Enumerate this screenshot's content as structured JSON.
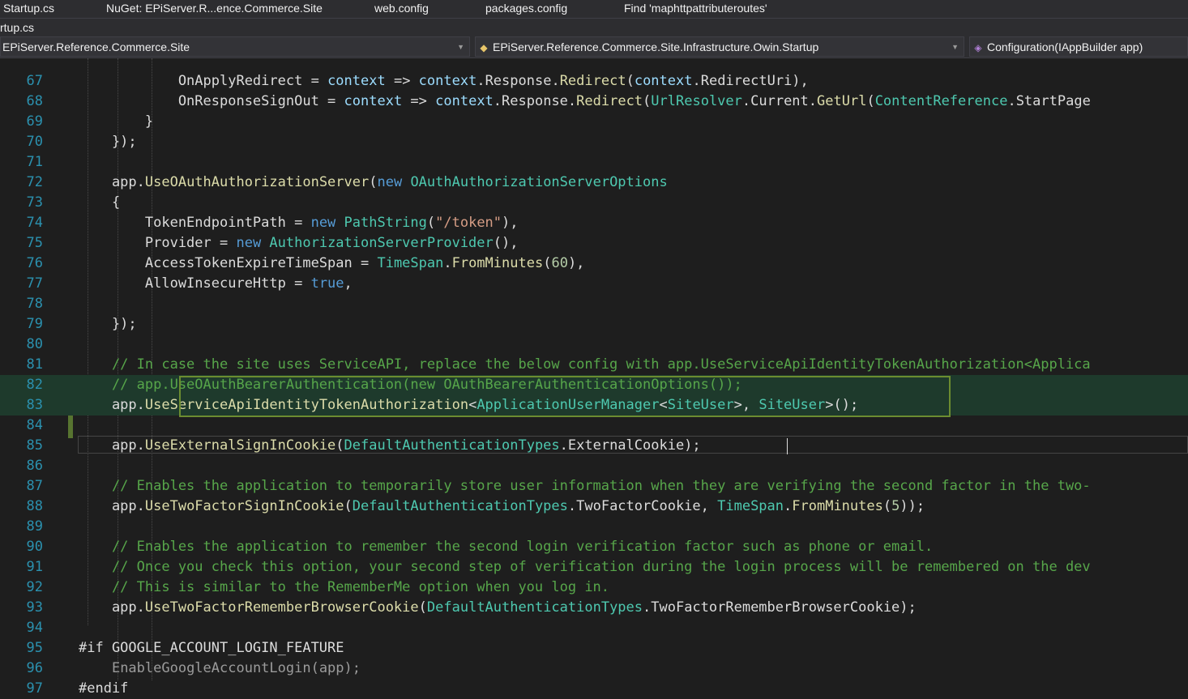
{
  "tabs": [
    {
      "label": "Startup.cs"
    },
    {
      "label": "NuGet: EPiServer.R...ence.Commerce.Site"
    },
    {
      "label": "web.config"
    },
    {
      "label": "packages.config"
    },
    {
      "label": "Find 'maphttpattributeroutes'"
    }
  ],
  "path_label": "rtup.cs",
  "navbar": {
    "project": "EPiServer.Reference.Commerce.Site",
    "type": "EPiServer.Reference.Commerce.Site.Infrastructure.Owin.Startup",
    "member": "Configuration(IAppBuilder app)"
  },
  "lines": [
    {
      "n": "",
      "tokens": [
        [
          "                                                  ",
          ""
        ],
        [
          "",
          ""
        ]
      ]
    },
    {
      "n": "67",
      "tokens": [
        [
          "            OnApplyRedirect ",
          ""
        ],
        [
          "= ",
          ""
        ],
        [
          "context",
          "pa"
        ],
        [
          " => ",
          ""
        ],
        [
          "context",
          "pa"
        ],
        [
          ".Response.",
          ""
        ],
        [
          "Redirect",
          "fn"
        ],
        [
          "(",
          ""
        ],
        [
          "context",
          "pa"
        ],
        [
          ".RedirectUri),",
          ""
        ]
      ]
    },
    {
      "n": "68",
      "tokens": [
        [
          "            OnResponseSignOut ",
          ""
        ],
        [
          "= ",
          ""
        ],
        [
          "context",
          "pa"
        ],
        [
          " => ",
          ""
        ],
        [
          "context",
          "pa"
        ],
        [
          ".Response.",
          ""
        ],
        [
          "Redirect",
          "fn"
        ],
        [
          "(",
          ""
        ],
        [
          "UrlResolver",
          "ty"
        ],
        [
          ".Current.",
          ""
        ],
        [
          "GetUrl",
          "fn"
        ],
        [
          "(",
          ""
        ],
        [
          "ContentReference",
          "ty"
        ],
        [
          ".StartPage",
          ""
        ]
      ]
    },
    {
      "n": "69",
      "tokens": [
        [
          "        }",
          ""
        ]
      ]
    },
    {
      "n": "70",
      "tokens": [
        [
          "    });",
          ""
        ]
      ]
    },
    {
      "n": "71",
      "tokens": []
    },
    {
      "n": "72",
      "tokens": [
        [
          "    app.",
          ""
        ],
        [
          "UseOAuthAuthorizationServer",
          "fn"
        ],
        [
          "(",
          ""
        ],
        [
          "new ",
          "kw"
        ],
        [
          "OAuthAuthorizationServerOptions",
          "ty"
        ]
      ]
    },
    {
      "n": "73",
      "tokens": [
        [
          "    {",
          ""
        ]
      ]
    },
    {
      "n": "74",
      "tokens": [
        [
          "        TokenEndpointPath = ",
          ""
        ],
        [
          "new ",
          "kw"
        ],
        [
          "PathString",
          "ty"
        ],
        [
          "(",
          ""
        ],
        [
          "\"/token\"",
          "st"
        ],
        [
          "),",
          ""
        ]
      ]
    },
    {
      "n": "75",
      "tokens": [
        [
          "        Provider = ",
          ""
        ],
        [
          "new ",
          "kw"
        ],
        [
          "AuthorizationServerProvider",
          "ty"
        ],
        [
          "(),",
          ""
        ]
      ]
    },
    {
      "n": "76",
      "tokens": [
        [
          "        AccessTokenExpireTimeSpan = ",
          ""
        ],
        [
          "TimeSpan",
          "ty"
        ],
        [
          ".",
          ""
        ],
        [
          "FromMinutes",
          "fn"
        ],
        [
          "(",
          ""
        ],
        [
          "60",
          "nm"
        ],
        [
          "),",
          ""
        ]
      ]
    },
    {
      "n": "77",
      "tokens": [
        [
          "        AllowInsecureHttp = ",
          ""
        ],
        [
          "true",
          "kw"
        ],
        [
          ",",
          ""
        ]
      ]
    },
    {
      "n": "78",
      "tokens": []
    },
    {
      "n": "79",
      "tokens": [
        [
          "    });",
          ""
        ]
      ]
    },
    {
      "n": "80",
      "tokens": []
    },
    {
      "n": "81",
      "tokens": [
        [
          "    // In case the site uses ServiceAPI, replace the below config with app.UseServiceApiIdentityTokenAuthorization<Applica",
          "cm"
        ]
      ]
    },
    {
      "n": "82",
      "tokens": [
        [
          "    // app.UseOAuthBearerAuthentication(new OAuthBearerAuthenticationOptions());",
          "cm"
        ]
      ]
    },
    {
      "n": "83",
      "tokens": [
        [
          "    app.",
          ""
        ],
        [
          "UseServiceApiIdentityTokenAuthorization",
          "fn"
        ],
        [
          "<",
          ""
        ],
        [
          "ApplicationUserManager",
          "ty"
        ],
        [
          "<",
          ""
        ],
        [
          "SiteUser",
          "ty"
        ],
        [
          ">, ",
          ""
        ],
        [
          "SiteUser",
          "ty"
        ],
        [
          ">();",
          ""
        ]
      ]
    },
    {
      "n": "84",
      "tokens": []
    },
    {
      "n": "85",
      "tokens": [
        [
          "    app.",
          ""
        ],
        [
          "UseExternalSignInCookie",
          "fn"
        ],
        [
          "(",
          ""
        ],
        [
          "DefaultAuthenticationTypes",
          "ty"
        ],
        [
          ".ExternalCookie);",
          ""
        ]
      ]
    },
    {
      "n": "86",
      "tokens": []
    },
    {
      "n": "87",
      "tokens": [
        [
          "    // Enables the application to temporarily store user information when they are verifying the second factor in the two-",
          "cm"
        ]
      ]
    },
    {
      "n": "88",
      "tokens": [
        [
          "    app.",
          ""
        ],
        [
          "UseTwoFactorSignInCookie",
          "fn"
        ],
        [
          "(",
          ""
        ],
        [
          "DefaultAuthenticationTypes",
          "ty"
        ],
        [
          ".TwoFactorCookie, ",
          ""
        ],
        [
          "TimeSpan",
          "ty"
        ],
        [
          ".",
          ""
        ],
        [
          "FromMinutes",
          "fn"
        ],
        [
          "(",
          ""
        ],
        [
          "5",
          "nm"
        ],
        [
          "));",
          ""
        ]
      ]
    },
    {
      "n": "89",
      "tokens": []
    },
    {
      "n": "90",
      "tokens": [
        [
          "    // Enables the application to remember the second login verification factor such as phone or email.",
          "cm"
        ]
      ]
    },
    {
      "n": "91",
      "tokens": [
        [
          "    // Once you check this option, your second step of verification during the login process will be remembered on the dev",
          "cm"
        ]
      ]
    },
    {
      "n": "92",
      "tokens": [
        [
          "    // This is similar to the RememberMe option when you log in.",
          "cm"
        ]
      ]
    },
    {
      "n": "93",
      "tokens": [
        [
          "    app.",
          ""
        ],
        [
          "UseTwoFactorRememberBrowserCookie",
          "fn"
        ],
        [
          "(",
          ""
        ],
        [
          "DefaultAuthenticationTypes",
          "ty"
        ],
        [
          ".TwoFactorRememberBrowserCookie);",
          ""
        ]
      ]
    },
    {
      "n": "94",
      "tokens": []
    },
    {
      "n": "95",
      "tokens": [
        [
          "#if GOOGLE_ACCOUNT_LOGIN_FEATURE",
          ""
        ]
      ]
    },
    {
      "n": "96",
      "tokens": [
        [
          "    ",
          ""
        ],
        [
          "EnableGoogleAccountLogin(app);",
          "pr"
        ]
      ]
    },
    {
      "n": "97",
      "tokens": [
        [
          "#endif",
          ""
        ]
      ]
    }
  ]
}
